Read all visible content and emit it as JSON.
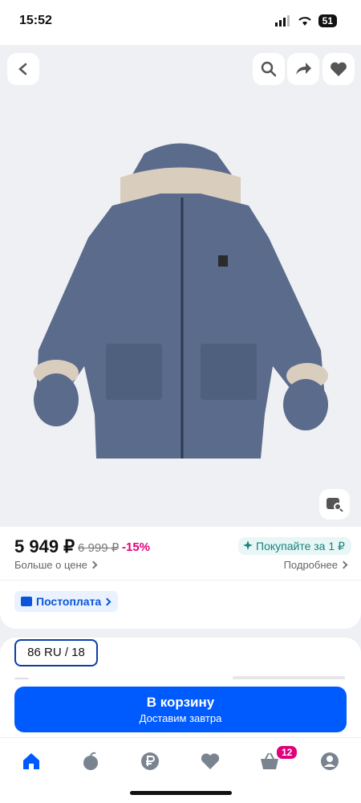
{
  "status": {
    "time": "15:52",
    "battery": "51"
  },
  "product": {
    "image_alt": "Детский пуховик синего цвета с варежками",
    "price": "5 949 ₽",
    "old_price": "6 999 ₽",
    "discount": "-15%",
    "buy_for": "Покупайте за 1 ₽",
    "more_price": "Больше о цене",
    "details": "Подробнее",
    "postpay": "Постоплата",
    "size": "86 RU / 18"
  },
  "cart": {
    "title": "В корзину",
    "subtitle": "Доставим завтра"
  },
  "tabbar": {
    "cart_badge": "12"
  },
  "colors": {
    "accent": "#005bff",
    "discount": "#e0007a",
    "jacket": "#5a6b8b"
  }
}
